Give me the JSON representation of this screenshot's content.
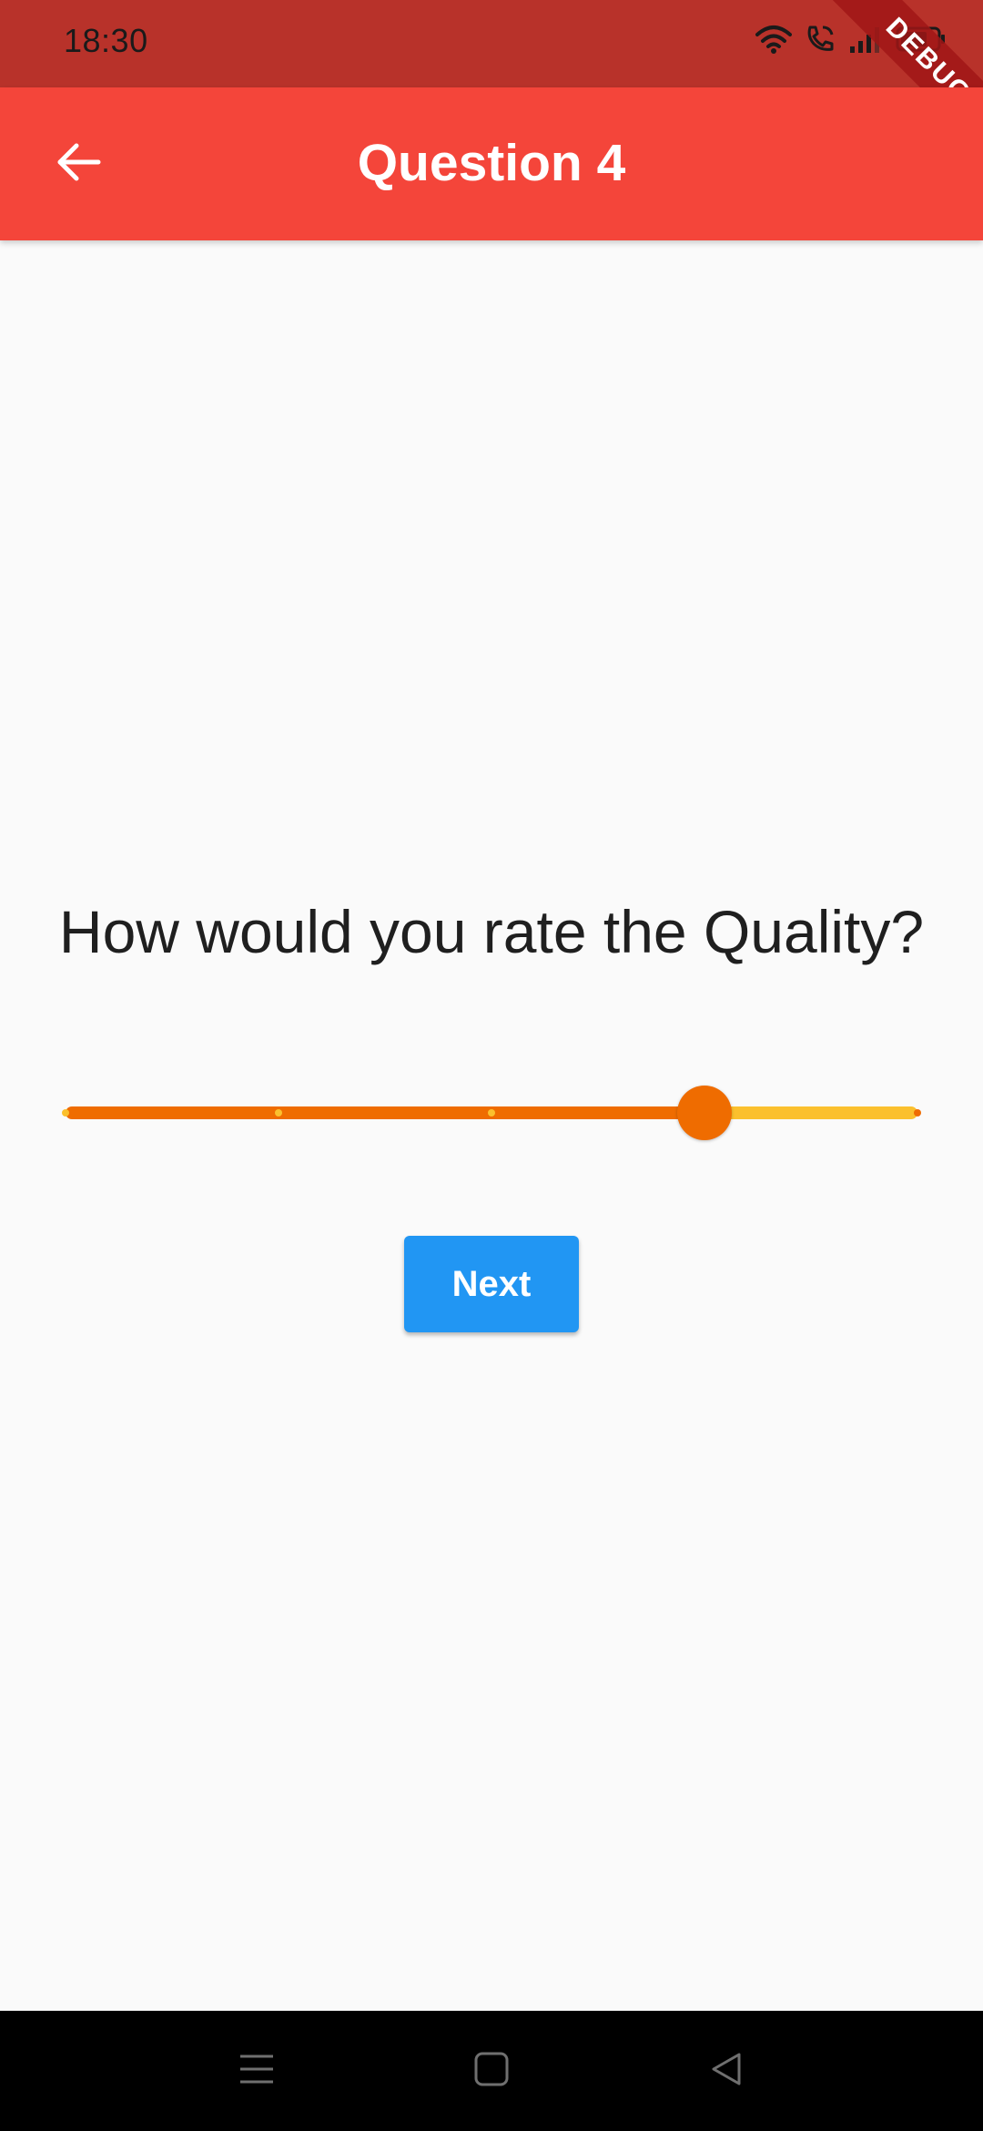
{
  "status_bar": {
    "time": "18:30",
    "icons": [
      "wifi-icon",
      "wifi-call-icon",
      "signal-icon",
      "battery-icon"
    ],
    "debug_banner": "DEBUG"
  },
  "app_bar": {
    "title": "Question 4",
    "back_icon": "arrow-back-icon",
    "color": "#f4453a"
  },
  "question": {
    "text": "How would you rate the Quality?"
  },
  "slider": {
    "min": 0,
    "max": 4,
    "divisions": 4,
    "value": 3,
    "active_color": "#ef6c00",
    "inactive_color": "#fbc02d"
  },
  "next_button": {
    "label": "Next",
    "color": "#2196f3"
  },
  "nav_bar": {
    "buttons": [
      "menu-icon",
      "home-icon",
      "back-icon"
    ]
  }
}
